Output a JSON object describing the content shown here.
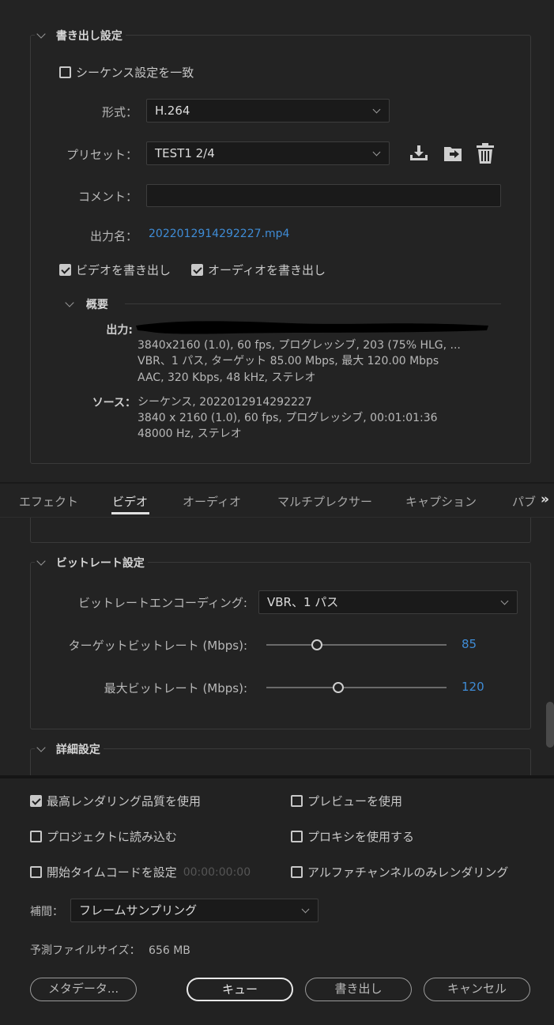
{
  "export_settings": {
    "title": "書き出し設定",
    "match_sequence_label": "シーケンス設定を一致",
    "match_sequence_checked": false,
    "format_label": "形式：",
    "format_value": "H.264",
    "preset_label": "プリセット：",
    "preset_value": "TEST1  2/4",
    "preset_icons": [
      "import-preset-icon",
      "save-preset-icon",
      "delete-preset-icon"
    ],
    "comment_label": "コメント：",
    "comment_value": "",
    "output_name_label": "出力名：",
    "output_name_value": "2022012914292227.mp4",
    "export_video_label": "ビデオを書き出し",
    "export_video_checked": true,
    "export_audio_label": "オーディオを書き出し",
    "export_audio_checked": true
  },
  "summary": {
    "title": "概要",
    "output_label": "出力:",
    "output_lines": [
      "3840x2160 (1.0), 60 fps, プログレッシブ, 203 (75% HLG, ...",
      "VBR、1 パス, ターゲット 85.00 Mbps, 最大  120.00 Mbps",
      "AAC, 320 Kbps, 48 kHz, ステレオ"
    ],
    "source_label": "ソース：",
    "source_lines": [
      "シーケンス, 2022012914292227",
      "3840 x 2160 (1.0), 60 fps, プログレッシブ, 00:01:01:36",
      "48000  Hz, ステレオ"
    ]
  },
  "tabs": {
    "items": [
      "エフェクト",
      "ビデオ",
      "オーディオ",
      "マルチプレクサー",
      "キャプション",
      "パブ"
    ],
    "active_index": 1,
    "overflow_icon": "double-chevron-right-icon"
  },
  "bitrate": {
    "title": "ビットレート設定",
    "encoding_label": "ビットレートエンコーディング:",
    "encoding_value": "VBR、1 パス",
    "target_label": "ターゲットビットレート (Mbps):",
    "target_value": "85",
    "target_fraction": 0.28,
    "max_label": "最大ビットレート (Mbps):",
    "max_value": "120",
    "max_fraction": 0.4
  },
  "advanced": {
    "title": "詳細設定"
  },
  "options": {
    "max_render_quality": "最高レンダリング品質を使用",
    "max_render_quality_checked": true,
    "use_previews": "プレビューを使用",
    "use_previews_checked": false,
    "import_into_project": "プロジェクトに読み込む",
    "import_into_project_checked": false,
    "use_proxies": "プロキシを使用する",
    "use_proxies_checked": false,
    "set_start_timecode": "開始タイムコードを設定",
    "set_start_timecode_checked": false,
    "start_timecode_value": "00:00:00:00",
    "render_alpha_only": "アルファチャンネルのみレンダリング",
    "render_alpha_only_checked": false,
    "interpolation_label": "補間：",
    "interpolation_value": "フレームサンプリング",
    "estimated_size_label": "予測ファイルサイズ：",
    "estimated_size_value": "656 MB"
  },
  "buttons": {
    "metadata": "メタデータ...",
    "queue": "キュー",
    "export": "書き出し",
    "cancel": "キャンセル"
  },
  "colors": {
    "background": "#232323",
    "link": "#3f8cd6",
    "text": "#c8c8c8"
  }
}
